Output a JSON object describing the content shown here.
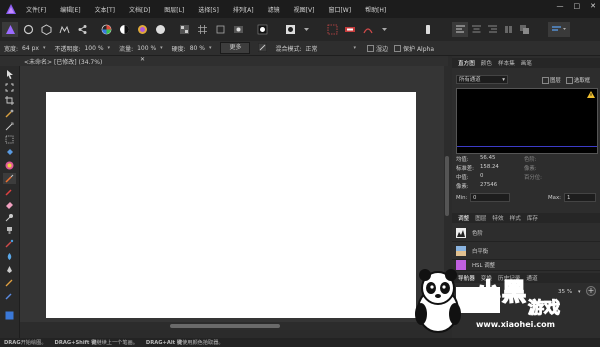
{
  "menu": [
    "文件[F]",
    "编辑[E]",
    "文本[T]",
    "文档[D]",
    "图层[L]",
    "选择[S]",
    "排列[A]",
    "滤镜",
    "视图[V]",
    "窗口[W]",
    "帮助[H]"
  ],
  "window_controls": {
    "minimize": "—",
    "maximize": "□",
    "close": "✕"
  },
  "context": {
    "width_label": "宽度:",
    "width_value": "64 px",
    "opacity_label": "不透明度:",
    "opacity_value": "100 %",
    "flow_label": "流量:",
    "flow_value": "100 %",
    "hardness_label": "硬度:",
    "hardness_value": "80 %",
    "more_label": "更多",
    "blend_label": "混合模式:",
    "blend_value": "正常",
    "wet_label": "湿边",
    "protect_alpha_label": "保护 Alpha"
  },
  "document": {
    "tab_label": "<未命名> [已修改] (34.7%)"
  },
  "panel_tabs_top": [
    "直方图",
    "颜色",
    "样本集",
    "画笔"
  ],
  "histogram": {
    "channel": "所有通道",
    "layer_label": "图层",
    "selection_label": "选取框",
    "stats": {
      "mean_label": "均值:",
      "mean_value": "56.45",
      "stddev_label": "标准差:",
      "stddev_value": "158.24",
      "median_label": "中值:",
      "median_value": "0",
      "pixels_label": "像素:",
      "pixels_value": "27546",
      "color_label": "色阶:",
      "pixel_label": "像素:",
      "percentile_label": "百分位:"
    },
    "min_label": "Min:",
    "min_value": "0",
    "max_label": "Max:",
    "max_value": "1"
  },
  "panel_tabs_mid": [
    "调整",
    "图层",
    "特效",
    "样式",
    "库存"
  ],
  "adjustments": [
    "色阶",
    "白平衡",
    "HSL 调整"
  ],
  "panel_tabs_bottom": [
    "导航器",
    "变换",
    "历史记录",
    "通道"
  ],
  "navigator": {
    "zoom": "35 %"
  },
  "status_bar": {
    "seg1_key": "DRAG",
    "seg1_text": " 开始绘图。",
    "seg2_key": "DRAG+Shift 键",
    "seg2_text": " 继续上一个笔画。",
    "seg3_key": "DRAG+Alt 键",
    "seg3_text": " 使用颜色拾取器。"
  },
  "watermark": {
    "line1": "小黑",
    "line2": "游戏",
    "url": "www.xiaohei.com"
  },
  "colors": {
    "accent": "#7b5bd6",
    "toolbar": "#262626",
    "canvas": "#ffffff"
  }
}
